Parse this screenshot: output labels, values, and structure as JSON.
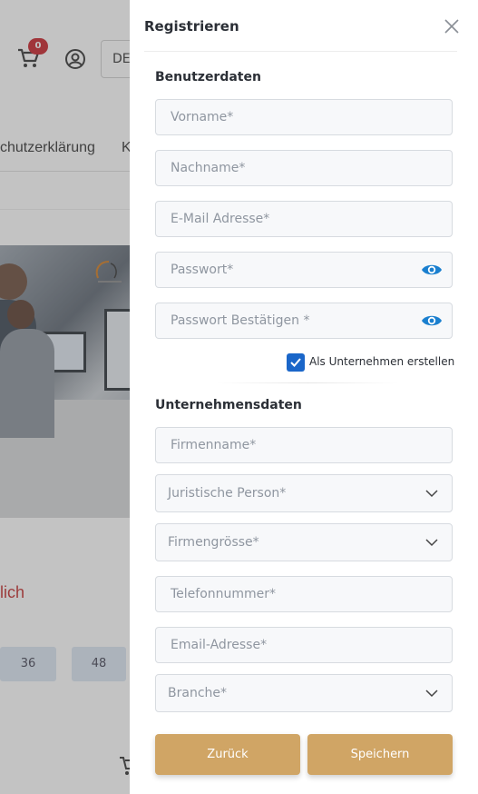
{
  "background": {
    "cart_count": "0",
    "language": "DE",
    "nav_text": "chutzerklärung",
    "nav_text_2": "K",
    "link_text": "lich",
    "chips": [
      "36",
      "48"
    ]
  },
  "drawer": {
    "title": "Registrieren",
    "user_section_title": "Benutzerdaten",
    "first_name_placeholder": "Vorname*",
    "last_name_placeholder": "Nachname*",
    "email_placeholder": "E-Mail Adresse*",
    "password_placeholder": "Passwort*",
    "password_confirm_placeholder": "Passwort Bestätigen *",
    "company_checkbox_label": "Als Unternehmen erstellen",
    "company_checkbox_checked": true,
    "company_section_title": "Unternehmensdaten",
    "company_name_placeholder": "Firmenname*",
    "legal_person_select": "Juristische Person*",
    "company_size_select": "Firmengrösse*",
    "phone_placeholder": "Telefonnummer*",
    "company_email_placeholder": "Email-Adresse*",
    "industry_select": "Branche*",
    "back_label": "Zurück",
    "save_label": "Speichern"
  },
  "colors": {
    "accent_button": "#d0a565",
    "checkbox": "#1a66c9",
    "eye_icon": "#1a7fcf",
    "badge": "#c8212a"
  },
  "icons": {
    "close": "close-icon",
    "password_toggle": "eye-icon",
    "dropdown": "chevron-down-icon",
    "cart": "cart-icon",
    "user": "user-icon"
  }
}
